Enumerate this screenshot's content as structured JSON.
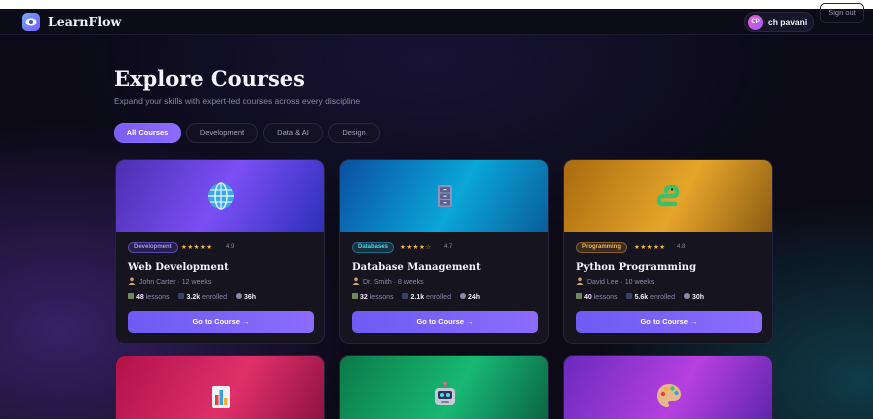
{
  "nav": {
    "brand": "LearnFlow",
    "user_initials": "CP",
    "user_name": "ch pavani",
    "signout_label": "Sign out"
  },
  "hero": {
    "title": "Explore Courses",
    "subtitle": "Expand your skills with expert-led courses across every discipline"
  },
  "filters": [
    {
      "label": "All Courses",
      "active": true
    },
    {
      "label": "Development",
      "active": false
    },
    {
      "label": "Data & AI",
      "active": false
    },
    {
      "label": "Design",
      "active": false
    }
  ],
  "courses": [
    {
      "badge": "Development",
      "badge_color": "#8b6cff",
      "stars": "★★★★★",
      "rating": "4.9",
      "title": "Web Development",
      "meta": "John Carter · 12 weeks",
      "lessons": "48",
      "lessons_label": "lessons",
      "enrolled": "3.2k",
      "enrolled_label": "enrolled",
      "duration": "36h",
      "button": "Go to Course →",
      "icon": "globe-icon"
    },
    {
      "badge": "Databases",
      "badge_color": "#2fc4e8",
      "stars": "★★★★☆",
      "rating": "4.7",
      "title": "Database Management",
      "meta": "Dr. Smith · 8 weeks",
      "lessons": "32",
      "lessons_label": "lessons",
      "enrolled": "2.1k",
      "enrolled_label": "enrolled",
      "duration": "24h",
      "button": "Go to Course →",
      "icon": "file-cabinet-icon"
    },
    {
      "badge": "Programming",
      "badge_color": "#f0a53a",
      "stars": "★★★★★",
      "rating": "4.8",
      "title": "Python Programming",
      "meta": "David Lee · 10 weeks",
      "lessons": "40",
      "lessons_label": "lessons",
      "enrolled": "5.6k",
      "enrolled_label": "enrolled",
      "duration": "30h",
      "button": "Go to Course →",
      "icon": "snake-icon"
    },
    {
      "icon": "bar-chart-icon"
    },
    {
      "icon": "robot-icon"
    },
    {
      "icon": "palette-icon"
    }
  ]
}
